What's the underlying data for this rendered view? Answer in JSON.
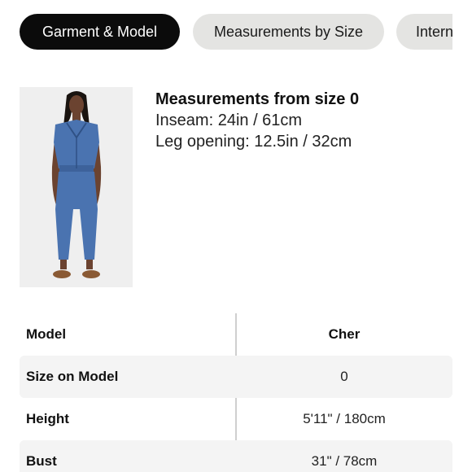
{
  "tabs": [
    {
      "label": "Garment & Model",
      "active": true
    },
    {
      "label": "Measurements by Size",
      "active": false
    },
    {
      "label": "Intern",
      "active": false
    }
  ],
  "product": {
    "image_description": "model-wearing-denim-jumpsuit-photo",
    "measurements_title": "Measurements from size 0",
    "inseam": "Inseam: 24in / 61cm",
    "leg_opening": "Leg opening: 12.5in / 32cm"
  },
  "model_table": {
    "rows": [
      {
        "label": "Model",
        "value": "Cher"
      },
      {
        "label": "Size on Model",
        "value": "0"
      },
      {
        "label": "Height",
        "value": "5'11\" / 180cm"
      },
      {
        "label": "Bust",
        "value": "31\" / 78cm"
      }
    ]
  },
  "colors": {
    "active_tab_bg": "#0b0b0b",
    "inactive_tab_bg": "#e4e4e2",
    "row_shade": "#f4f4f4",
    "denim": "#4a73b0"
  }
}
